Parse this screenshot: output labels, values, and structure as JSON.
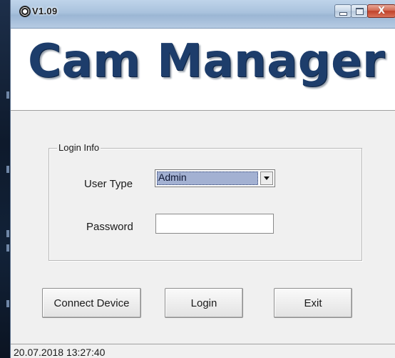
{
  "window": {
    "title": "V1.09",
    "icon": "camera-lens-icon",
    "controls": {
      "minimize_icon": "minimize-icon",
      "maximize_icon": "maximize-icon",
      "close_icon": "close-icon",
      "close_glyph": "X"
    }
  },
  "banner": {
    "title": "Cam Manager",
    "color": "#1d3d6b"
  },
  "login_group": {
    "legend": "Login Info",
    "user_type": {
      "label": "User Type",
      "selected": "Admin",
      "dropdown_icon": "chevron-down-icon"
    },
    "password": {
      "label": "Password",
      "value": ""
    }
  },
  "buttons": {
    "connect": "Connect Device",
    "login": "Login",
    "exit": "Exit"
  },
  "status_bar": {
    "text": "20.07.2018 13:27:40"
  },
  "colors": {
    "titlebar": "#a9c2dd",
    "close_button": "#c0412a",
    "selection_highlight": "#a3b1d2",
    "window_background": "#f0f0f0"
  }
}
